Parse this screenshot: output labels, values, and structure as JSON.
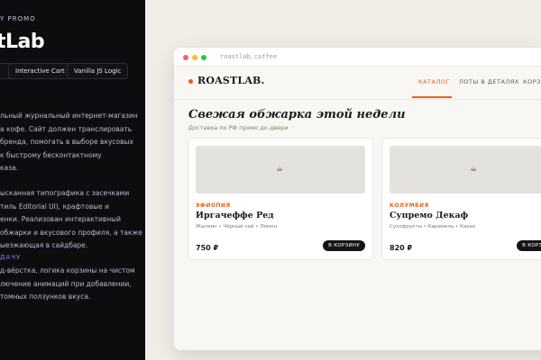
{
  "promo": {
    "label": "Y PROMO",
    "brand": "tLab",
    "pills": [
      "",
      "Interactive Cart",
      "Vanilla JS Logic"
    ],
    "description": "льный журнальный интернет-магазин\nа кофе. Сайт должен транслировать\nбренда, помогать в выборе вкусовых\nк быстрому бесконтактному\nказа.",
    "design": "ысканная типографика с засечками\nтиль Editorial UI), крафтовые и\nенки. Реализован интерактивный\nобжарки и вкусового профиля, а также\nыезжающая в сайдбаре.",
    "task_label": "ДАЧУ",
    "task": "д-вёрстка, логика корзины на чистом\nлючение анимаций при добавлении,\nтомных ползунков вкуса."
  },
  "browser": {
    "url": "roastlab.coffee"
  },
  "site": {
    "logo": "ROASTLAB.",
    "nav": [
      "КАТАЛОГ",
      "ЛОТЫ В ДЕТАЛЯХ",
      "КОРЗИ"
    ],
    "heading": "Свежая обжарка этой недели",
    "subheading": "Доставка по РФ прямо до двери",
    "products": [
      {
        "origin": "ЭФИОПИЯ",
        "name": "Иргачеффе Ред",
        "notes": "Жасмин • Чёрный чай • Лимон",
        "price": "750 ₽",
        "button": "В КОРЗИНУ"
      },
      {
        "origin": "КОЛУМБИЯ",
        "name": "Супремо Декаф",
        "notes": "Сухофрукты • Карамель • Какао",
        "price": "820 ₽",
        "button": "В КОРЗИНУ"
      }
    ]
  },
  "colors": {
    "accent": "#e8601c",
    "dark_panel": "#0d0d10",
    "page_bg": "#f0ece6"
  },
  "icons": {
    "product_image": "coffee-cup-icon"
  }
}
